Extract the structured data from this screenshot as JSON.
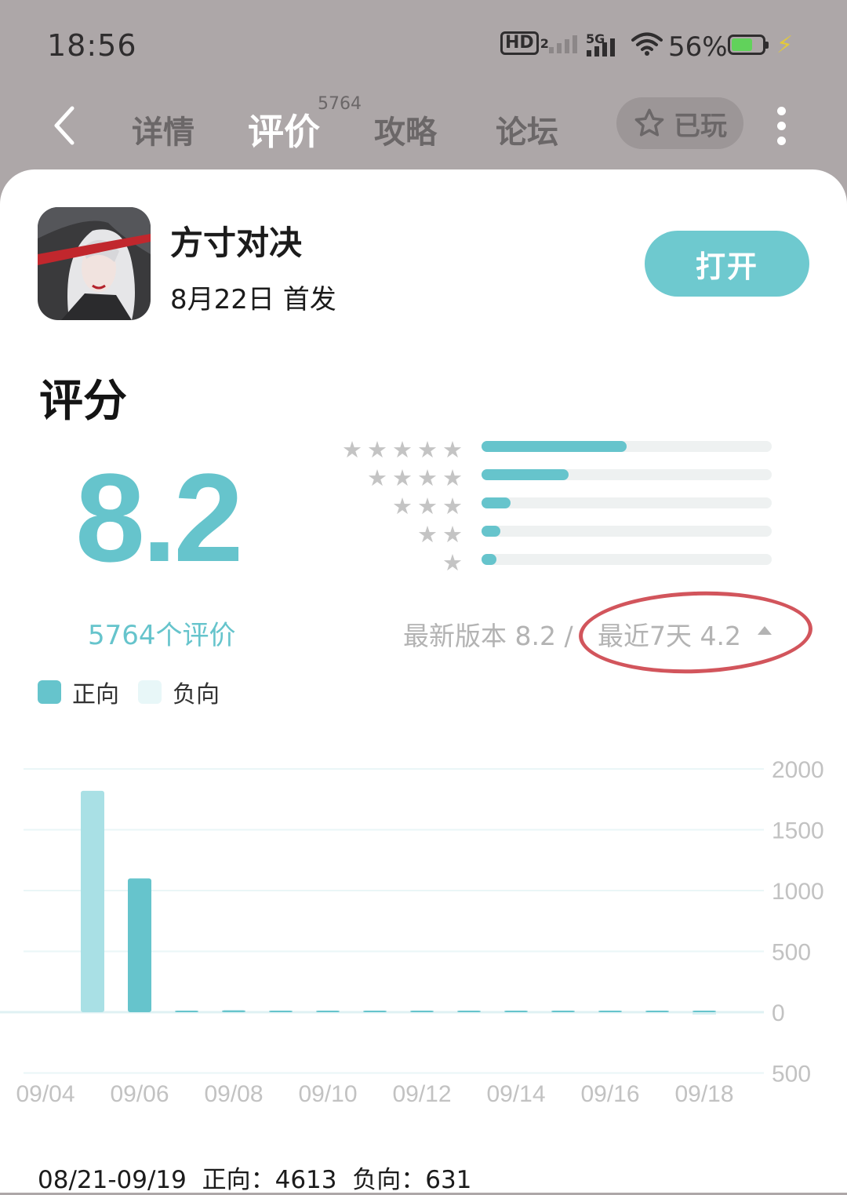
{
  "status": {
    "time": "18:56",
    "hd": "HD",
    "hd_sub": "2",
    "network": "5G",
    "battery_pct": "56%"
  },
  "nav": {
    "tabs": [
      {
        "label": "详情"
      },
      {
        "label": "评价",
        "active": true,
        "badge": "5764"
      },
      {
        "label": "攻略"
      },
      {
        "label": "论坛"
      }
    ],
    "played_label": "已玩"
  },
  "game": {
    "name": "方寸对决",
    "release": "8月22日 首发",
    "open_label": "打开"
  },
  "rating": {
    "section_title": "评分",
    "score": "8.2",
    "review_count": "5764个评价",
    "distribution": [
      {
        "stars": 5,
        "fraction": 0.5
      },
      {
        "stars": 4,
        "fraction": 0.3
      },
      {
        "stars": 3,
        "fraction": 0.1
      },
      {
        "stars": 2,
        "fraction": 0.065
      },
      {
        "stars": 1,
        "fraction": 0.05
      }
    ],
    "latest_version": "最新版本 8.2",
    "separator": "/",
    "recent_7days": "最近7天 4.2"
  },
  "legend": {
    "positive": "正向",
    "negative": "负向"
  },
  "colors": {
    "accent": "#66c4cc",
    "negative_bar": "#d6eff1",
    "annotation": "#d2555c"
  },
  "chart_data": {
    "type": "bar",
    "x": [
      "09/04",
      "09/05",
      "09/06",
      "09/07",
      "09/08",
      "09/09",
      "09/10",
      "09/11",
      "09/12",
      "09/13",
      "09/14",
      "09/15",
      "09/16",
      "09/17",
      "09/18",
      "09/19"
    ],
    "x_tick_labels": [
      "09/04",
      "09/06",
      "09/08",
      "09/10",
      "09/12",
      "09/14",
      "09/16",
      "09/18"
    ],
    "series": [
      {
        "name": "正向",
        "values": [
          0,
          1820,
          1100,
          10,
          15,
          8,
          8,
          10,
          8,
          5,
          8,
          8,
          5,
          5,
          5,
          0
        ]
      },
      {
        "name": "负向",
        "values": [
          0,
          0,
          0,
          0,
          0,
          0,
          0,
          0,
          0,
          0,
          0,
          0,
          0,
          0,
          20,
          0
        ]
      }
    ],
    "y_ticks": [
      "2000",
      "1500",
      "1000",
      "500",
      "0",
      "500"
    ],
    "ylim": [
      -500,
      2000
    ],
    "grid": true
  },
  "footer": {
    "range": "08/21-09/19",
    "positive": "正向：4613",
    "negative": "负向：631"
  }
}
